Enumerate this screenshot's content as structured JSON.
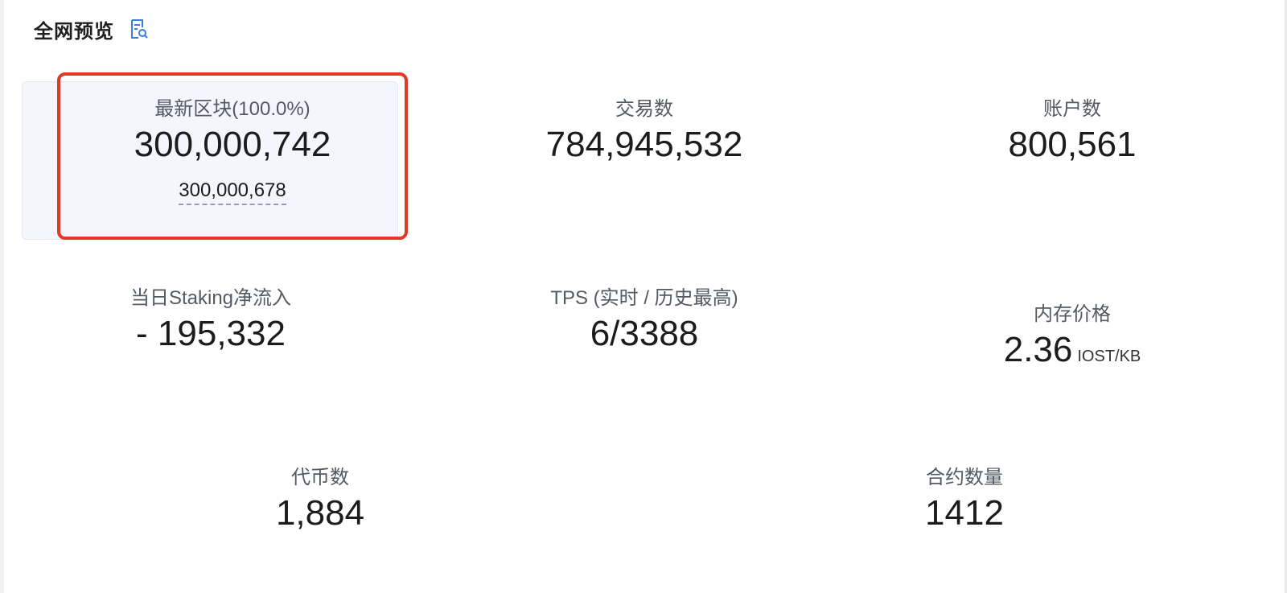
{
  "header": {
    "title": "全网预览",
    "icon": "document-search-icon",
    "accent_color": "#3b7ddd"
  },
  "highlight_color": "#e03a24",
  "stats": {
    "latest_block": {
      "label": "最新区块(100.0%)",
      "value": "300,000,742",
      "sub_value": "300,000,678"
    },
    "transactions": {
      "label": "交易数",
      "value": "784,945,532"
    },
    "accounts": {
      "label": "账户数",
      "value": "800,561"
    },
    "staking_inflow": {
      "label": "当日Staking净流入",
      "value": "- 195,332"
    },
    "tps": {
      "label": "TPS (实时 / 历史最高)",
      "value": "6/3388"
    },
    "ram_price": {
      "label": "内存价格",
      "value": "2.36",
      "unit": "IOST/KB"
    },
    "tokens": {
      "label": "代币数",
      "value": "1,884"
    },
    "contracts": {
      "label": "合约数量",
      "value": "1412"
    }
  }
}
